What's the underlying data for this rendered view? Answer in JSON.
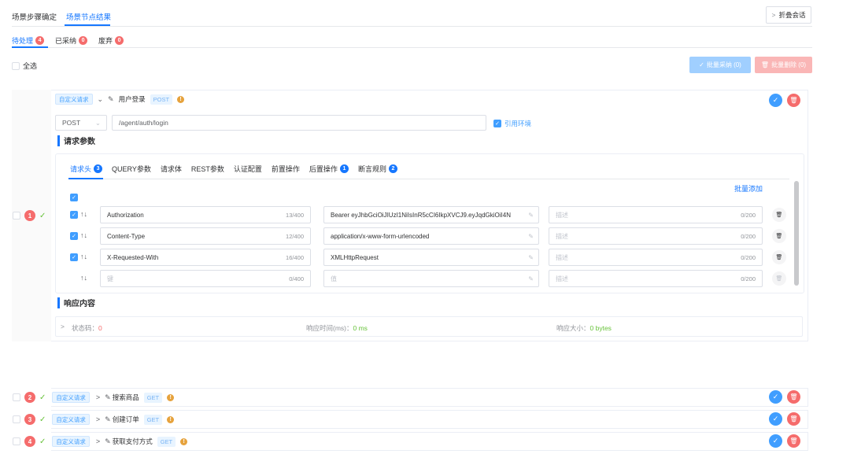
{
  "top_tabs": [
    "场景步骤确定",
    "场景节点结果"
  ],
  "collapse_button": "折叠会话",
  "sub_tabs": [
    {
      "label": "待处理",
      "count": "4"
    },
    {
      "label": "已采纳",
      "count": "0"
    },
    {
      "label": "废弃",
      "count": "0"
    }
  ],
  "select_all": "全选",
  "bulk_accept": "批量采纳 (0)",
  "bulk_delete": "批量删除 (0)",
  "steps": [
    {
      "num": "1",
      "tag": "自定义请求",
      "name": "用户登录",
      "method": "POST"
    },
    {
      "num": "2",
      "tag": "自定义请求",
      "name": "搜索商品",
      "method": "GET"
    },
    {
      "num": "3",
      "tag": "自定义请求",
      "name": "创建订单",
      "method": "GET"
    },
    {
      "num": "4",
      "tag": "自定义请求",
      "name": "获取支付方式",
      "method": "GET"
    }
  ],
  "request": {
    "method": "POST",
    "url": "/agent/auth/login",
    "use_env": "引用环境"
  },
  "section_params": "请求参数",
  "param_tabs": [
    {
      "label": "请求头",
      "count": "3"
    },
    {
      "label": "QUERY参数",
      "count": ""
    },
    {
      "label": "请求体",
      "count": ""
    },
    {
      "label": "REST参数",
      "count": ""
    },
    {
      "label": "认证配置",
      "count": ""
    },
    {
      "label": "前置操作",
      "count": ""
    },
    {
      "label": "后置操作",
      "count": "1"
    },
    {
      "label": "断言规则",
      "count": "2"
    }
  ],
  "bulk_add": "批量添加",
  "headers": [
    {
      "key": "Authorization",
      "key_count": "13/400",
      "value": "Bearer eyJhbGciOiJIUzI1NiIsInR5cCI6IkpXVCJ9.eyJqdGkiOiI4N",
      "desc_ph": "描述",
      "desc_count": "0/200"
    },
    {
      "key": "Content-Type",
      "key_count": "12/400",
      "value": "application/x-www-form-urlencoded",
      "desc_ph": "描述",
      "desc_count": "0/200"
    },
    {
      "key": "X-Requested-With",
      "key_count": "16/400",
      "value": "XMLHttpRequest",
      "desc_ph": "描述",
      "desc_count": "0/200"
    }
  ],
  "empty_row": {
    "key_ph": "键",
    "key_count": "0/400",
    "value_ph": "值",
    "desc_ph": "描述",
    "desc_count": "0/200"
  },
  "section_response": "响应内容",
  "response": {
    "status_label": "状态码：",
    "status_value": "0",
    "time_label": "响应时间(ms)：",
    "time_value": "0 ms",
    "size_label": "响应大小：",
    "size_value": "0 bytes"
  }
}
